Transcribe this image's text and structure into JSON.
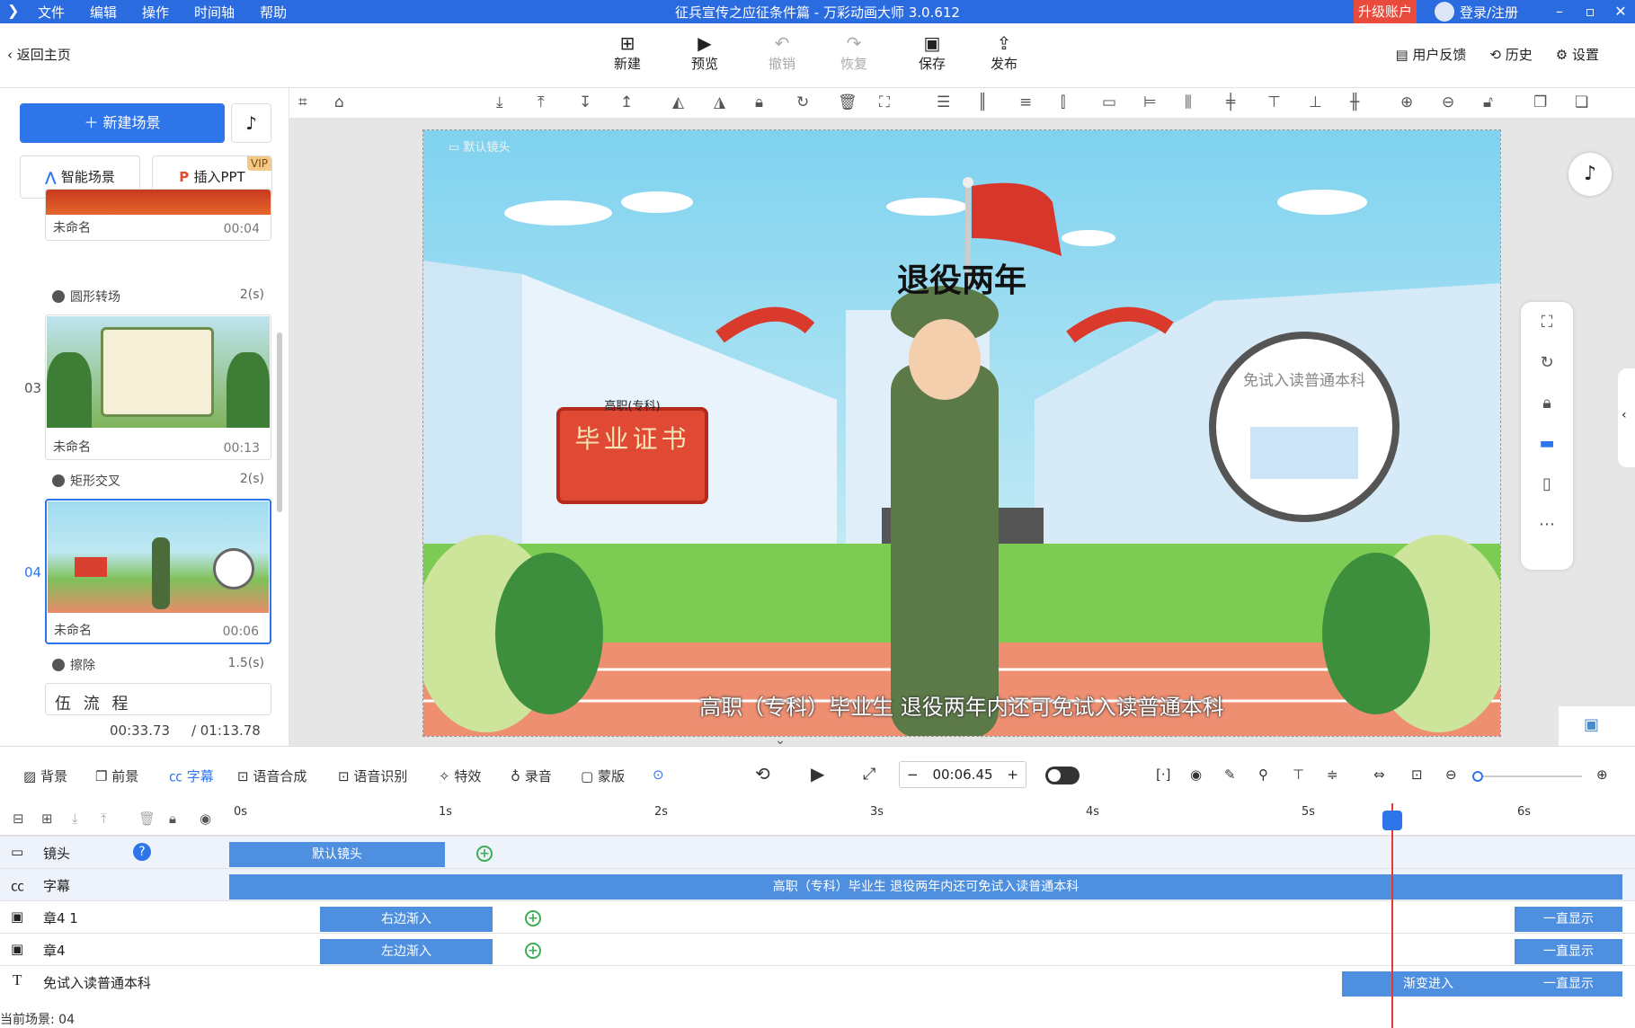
{
  "window": {
    "title": "征兵宣传之应征条件篇 - 万彩动画大师 3.0.612",
    "menu": [
      "文件",
      "编辑",
      "操作",
      "时间轴",
      "帮助"
    ],
    "upgrade": "升级账户",
    "login": "登录/注册"
  },
  "toolbar": {
    "back": "返回主页",
    "buttons": [
      "新建",
      "预览",
      "撤销",
      "恢复",
      "保存",
      "发布"
    ],
    "right": [
      "用户反馈",
      "历史",
      "设置"
    ]
  },
  "left": {
    "new_scene": "新建场景",
    "smart": "智能场景",
    "ppt": "插入PPT",
    "vip": "VIP",
    "scenes": [
      {
        "num": "",
        "name": "未命名",
        "dur": "00:04",
        "trans": "圆形转场",
        "tdur": "2(s)"
      },
      {
        "num": "03",
        "name": "未命名",
        "dur": "00:13",
        "trans": "矩形交叉",
        "tdur": "2(s)"
      },
      {
        "num": "04",
        "name": "未命名",
        "dur": "00:06",
        "trans": "擦除",
        "tdur": "1.5(s)"
      }
    ],
    "next_title": "伍 流 程",
    "time_current": "00:33.73",
    "time_total": "/ 01:13.78"
  },
  "stage": {
    "camera": "默认镜头",
    "headline": "退役两年",
    "cert_top": "高职(专科)",
    "cert_main": "毕业证书",
    "circle_text": "免试入读普通本科",
    "subtitle": "高职（专科）毕业生 退役两年内还可免试入读普通本科"
  },
  "layers": {
    "items": [
      "背景",
      "前景",
      "字幕",
      "语音合成",
      "语音识别",
      "特效",
      "录音",
      "蒙版"
    ],
    "timecode": "00:06.45"
  },
  "timeline": {
    "ticks": [
      "0s",
      "1s",
      "2s",
      "3s",
      "4s",
      "5s",
      "6s"
    ],
    "tracks": [
      {
        "name": "镜头",
        "clips": [
          "默认镜头"
        ]
      },
      {
        "name": "字幕",
        "clips": [
          "高职（专科）毕业生 退役两年内还可免试入读普通本科"
        ]
      },
      {
        "name": "章4 1",
        "clips": [
          "右边渐入",
          "一直显示"
        ]
      },
      {
        "name": "章4",
        "clips": [
          "左边渐入",
          "一直显示"
        ]
      },
      {
        "name": "免试入读普通本科",
        "clips": [
          "渐变进入",
          "一直显示"
        ]
      }
    ],
    "status": "当前场景: 04"
  }
}
